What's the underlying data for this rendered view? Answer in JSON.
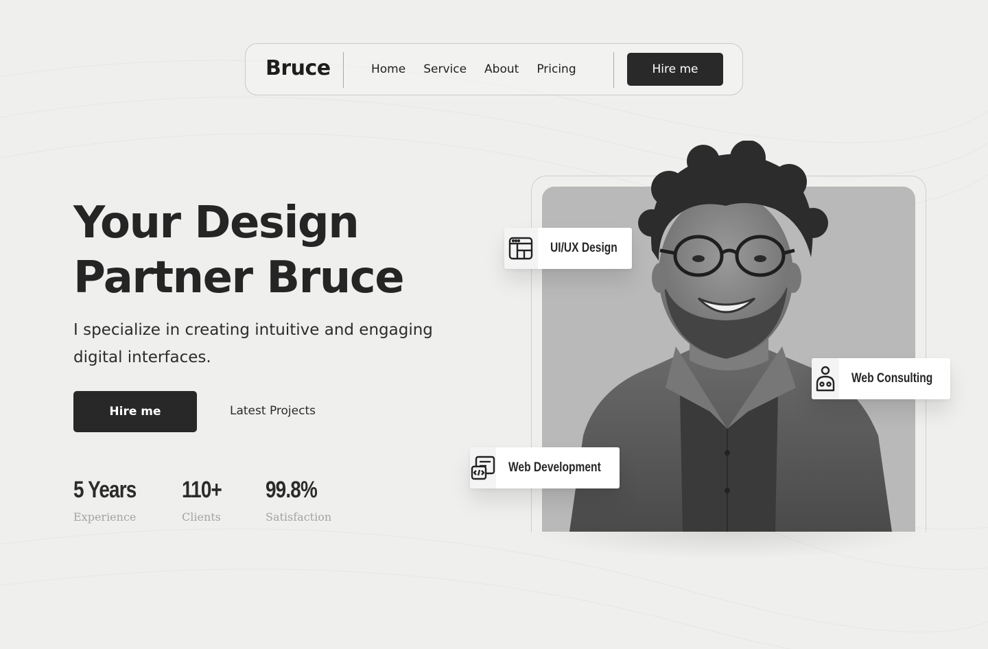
{
  "nav": {
    "brand": "Bruce",
    "links": [
      "Home",
      "Service",
      "About",
      "Pricing"
    ],
    "cta": "Hire me"
  },
  "hero": {
    "title_line1": "Your Design",
    "title_line2": "Partner Bruce",
    "subtitle": "I specialize in creating intuitive and engaging digital interfaces.",
    "primary_button": "Hire me",
    "secondary_link": "Latest Projects"
  },
  "stats": [
    {
      "value": "5 Years",
      "label": "Experience"
    },
    {
      "value": "110+",
      "label": "Clients"
    },
    {
      "value": "99.8%",
      "label": "Satisfaction"
    }
  ],
  "services": [
    {
      "label": "UI/UX Design",
      "icon": "layout-grid-icon"
    },
    {
      "label": "Web Consulting",
      "icon": "user-consulting-icon"
    },
    {
      "label": "Web Development",
      "icon": "code-window-icon"
    }
  ],
  "portrait": {
    "icon": "portrait-photo"
  },
  "colors": {
    "background": "#efefed",
    "dark": "#282828",
    "muted": "#a3a3a1",
    "photo_bg": "#b9b9b9"
  }
}
